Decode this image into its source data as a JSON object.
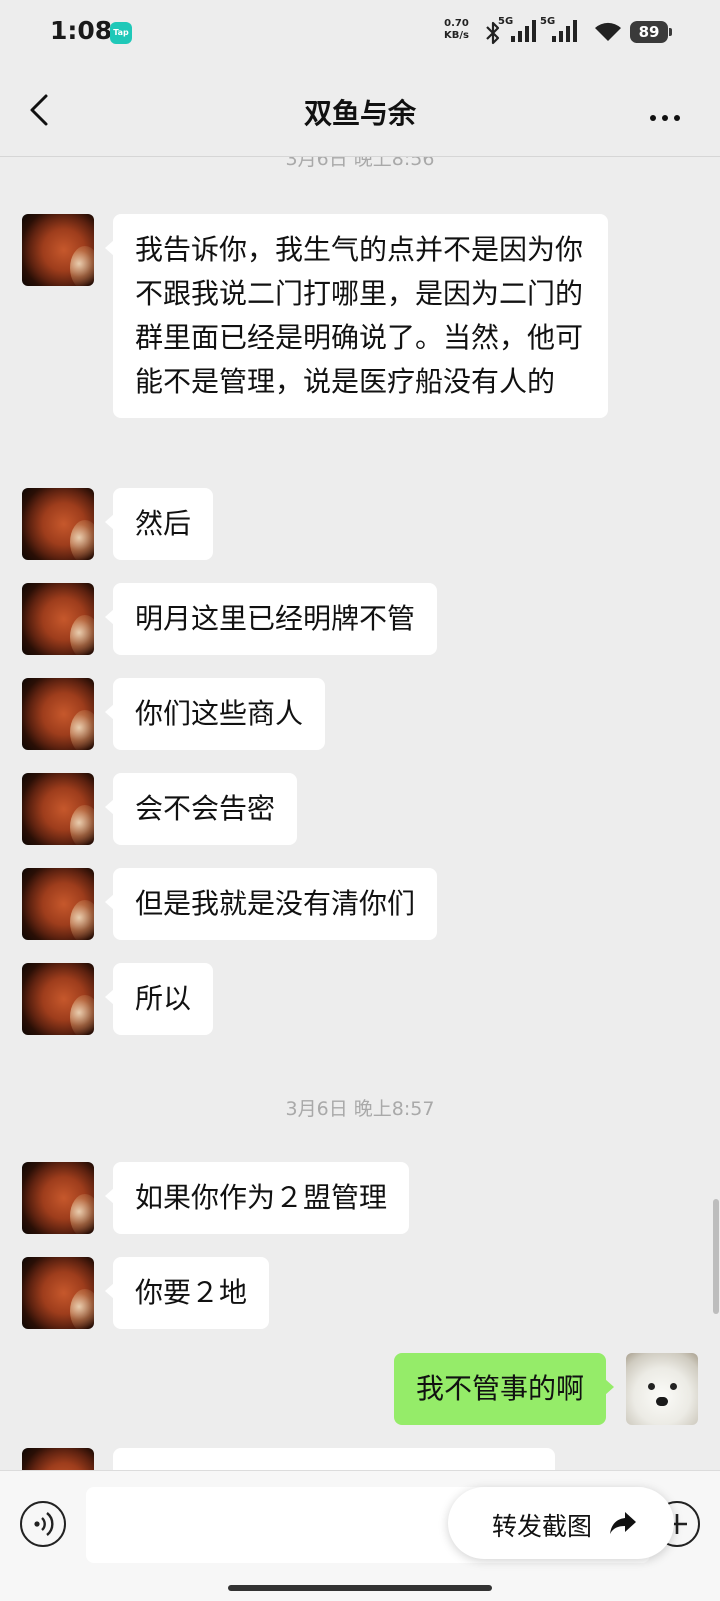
{
  "status_bar": {
    "time": "1:08",
    "tap_badge": "Tap",
    "net_speed_value": "0.70",
    "net_speed_unit": "KB/s",
    "signal1_label": "5G",
    "signal2_label": "5G",
    "battery": "89"
  },
  "header": {
    "title": "双鱼与余"
  },
  "chat": {
    "dividers": {
      "first": "3月6日 晚上8:56",
      "second": "3月6日 晚上8:57"
    },
    "messages": [
      {
        "sender": "other",
        "text": "我告诉你，我生气的点并不是因为你不跟我说二门打哪里，是因为二门的群里面已经是明确说了。当然，他可能不是管理，说是医疗船没有人的"
      },
      {
        "sender": "other",
        "text": "然后"
      },
      {
        "sender": "other",
        "text": "明月这里已经明牌不管"
      },
      {
        "sender": "other",
        "text": "你们这些商人"
      },
      {
        "sender": "other",
        "text": "会不会告密"
      },
      {
        "sender": "other",
        "text": "但是我就是没有清你们"
      },
      {
        "sender": "other",
        "text": "所以"
      },
      {
        "sender": "other",
        "text": "如果你作为２盟管理"
      },
      {
        "sender": "other",
        "text": "你要２地"
      },
      {
        "sender": "me",
        "text": "我不管事的啊"
      }
    ]
  },
  "input_bar": {
    "text_value": "",
    "forward_label": "转发截图"
  },
  "icons": {
    "back": "chevron-left-icon",
    "more": "more-dots-icon",
    "voice": "voice-icon",
    "plus": "plus-icon",
    "forward": "share-arrow-icon"
  }
}
